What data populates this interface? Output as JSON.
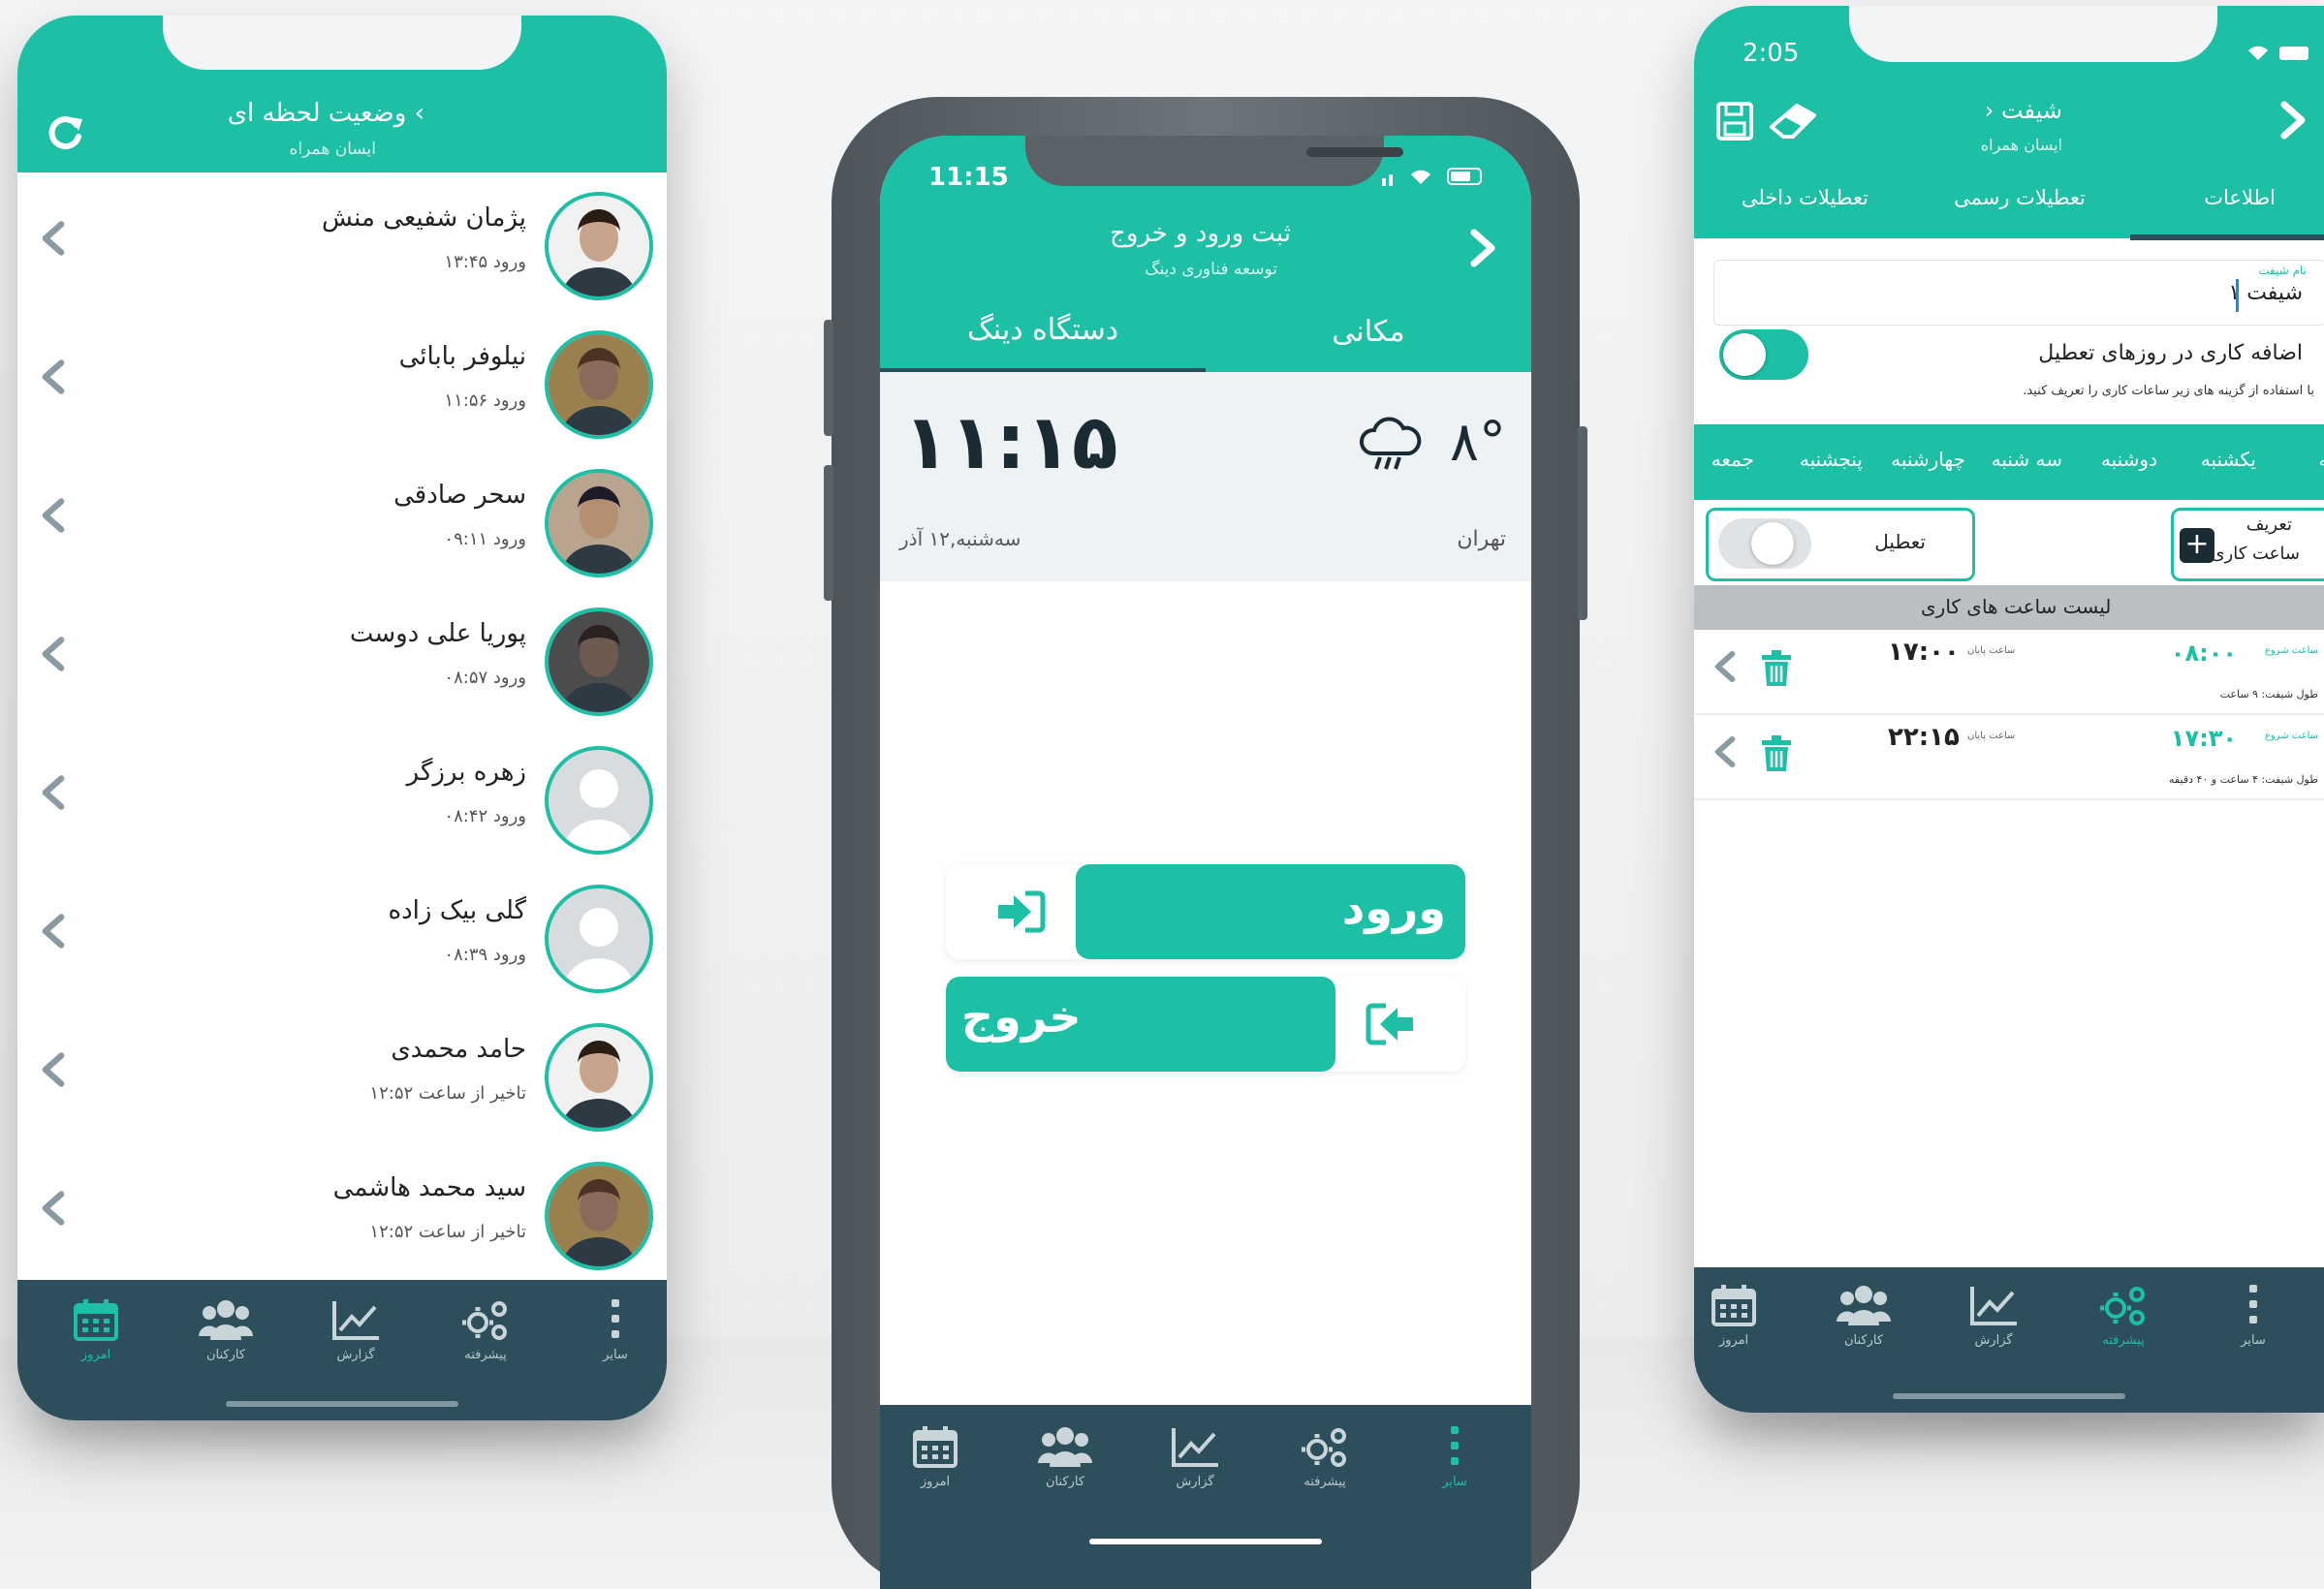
{
  "colors": {
    "teal": "#1dbfa5",
    "dark": "#2d4f5c",
    "text": "#222222"
  },
  "left_phone": {
    "header": {
      "title": "وضعیت لحظه ای ‹",
      "subtitle": "ایسان همراه"
    },
    "employees": [
      {
        "name": "پژمان شفیعی منش",
        "status": "ورود ۱۳:۴۵",
        "avatar": "photo"
      },
      {
        "name": "نیلوفر بابائی",
        "status": "ورود ۱۱:۵۶",
        "avatar": "photo"
      },
      {
        "name": "سحر صادقی",
        "status": "ورود ۰۹:۱۱",
        "avatar": "photo"
      },
      {
        "name": "پوریا علی دوست",
        "status": "ورود ۰۸:۵۷",
        "avatar": "photo"
      },
      {
        "name": "زهره برزگر",
        "status": "ورود ۰۸:۴۲",
        "avatar": "placeholder"
      },
      {
        "name": "گلی بیک زاده",
        "status": "ورود ۰۸:۳۹",
        "avatar": "placeholder"
      },
      {
        "name": "حامد محمدی",
        "status": "تاخیر از ساعت ۱۲:۵۲",
        "avatar": "photo"
      },
      {
        "name": "سید محمد هاشمی",
        "status": "تاخیر از ساعت ۱۲:۵۲",
        "avatar": "photo"
      }
    ],
    "tabs": [
      {
        "label": "امروز",
        "icon": "calendar-icon",
        "active": true
      },
      {
        "label": "کارکنان",
        "icon": "users-icon",
        "active": false
      },
      {
        "label": "گزارش",
        "icon": "chart-icon",
        "active": false
      },
      {
        "label": "پیشرفته",
        "icon": "gears-icon",
        "active": false
      },
      {
        "label": "سایر",
        "icon": "more-icon",
        "active": false
      }
    ]
  },
  "middle_phone": {
    "status_time": "11:15",
    "header": {
      "title": "ثبت ورود و خروج",
      "subtitle": "توسعه فناوری دینگ"
    },
    "segments": {
      "left": "دستگاه دینگ",
      "right": "مکانی",
      "selected": "left"
    },
    "clock": "۱۱:۱۵",
    "temperature": "۸°",
    "weather_icon": "rain-cloud-icon",
    "date": "سه‌شنبه,۱۲ آذر",
    "city": "تهران",
    "enter_label": "ورود",
    "exit_label": "خروج",
    "tabs": [
      {
        "label": "امروز",
        "icon": "calendar-icon",
        "active": false
      },
      {
        "label": "کارکنان",
        "icon": "users-icon",
        "active": false
      },
      {
        "label": "گزارش",
        "icon": "chart-icon",
        "active": false
      },
      {
        "label": "پیشرفته",
        "icon": "gears-icon",
        "active": false
      },
      {
        "label": "سایر",
        "icon": "more-icon",
        "active": true
      }
    ]
  },
  "right_phone": {
    "status_time": "2:05",
    "header": {
      "title": "شیفت ‹",
      "subtitle": "ایسان همراه"
    },
    "top_tabs": [
      "اطلاعات",
      "تعطیلات رسمی",
      "تعطیلات داخلی"
    ],
    "shift_name_label": "نام شیفت",
    "shift_name_value": "شیفت ۱",
    "holiday_work_label": "اضافه کاری در روزهای تعطیل",
    "holiday_work_help": "با استفاده از گزینه های زیر ساعات کاری را تعریف کنید.",
    "holiday_work_enabled": true,
    "days": [
      "شنبه",
      "یکشنبه",
      "دوشنبه",
      "سه شنبه",
      "چهارشنبه",
      "پنجشنبه",
      "جمعه"
    ],
    "define_label_1": "تعریف",
    "define_label_2": "ساعت کاری",
    "off_label": "تعطیل",
    "off_enabled": false,
    "list_title": "لیست ساعت های کاری",
    "work_hours": [
      {
        "start": "۰۸:۰۰",
        "start_label": "ساعت شروع",
        "end": "۱۷:۰۰",
        "end_label": "ساعت پایان",
        "duration": "طول شیفت: ۹ ساعت"
      },
      {
        "start": "۱۷:۳۰",
        "start_label": "ساعت شروع",
        "end": "۲۲:۱۵",
        "end_label": "ساعت پایان",
        "duration": "طول شیفت: ۴ ساعت و ۴۰ دقیقه"
      }
    ],
    "tabs": [
      {
        "label": "امروز",
        "icon": "calendar-icon",
        "active": false
      },
      {
        "label": "کارکنان",
        "icon": "users-icon",
        "active": false
      },
      {
        "label": "گزارش",
        "icon": "chart-icon",
        "active": false
      },
      {
        "label": "پیشرفته",
        "icon": "gears-icon",
        "active": true
      },
      {
        "label": "سایر",
        "icon": "more-icon",
        "active": false
      }
    ]
  }
}
